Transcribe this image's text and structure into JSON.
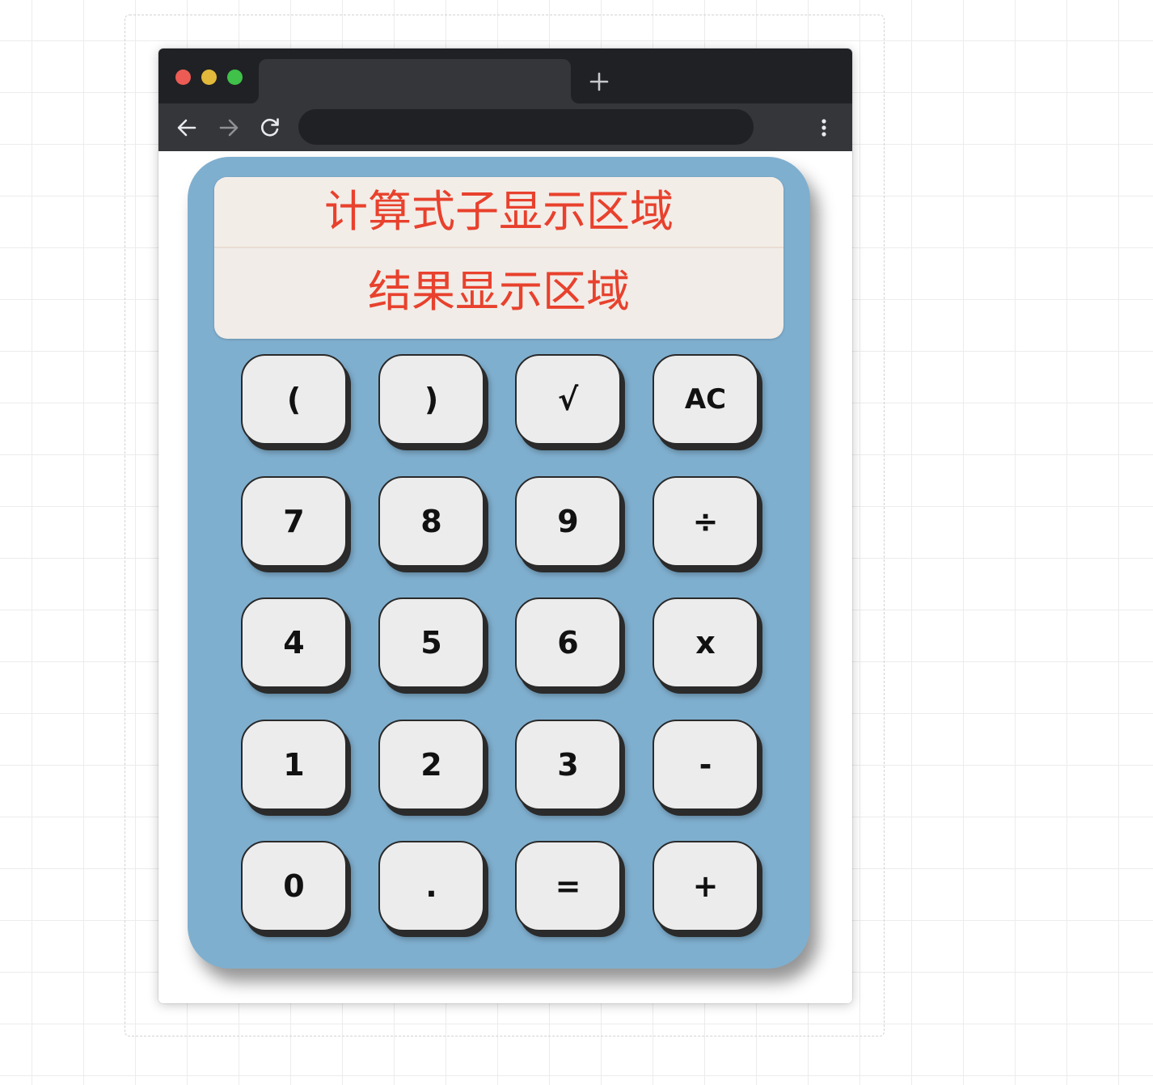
{
  "browser": {
    "tab_title": "",
    "address_bar_value": "",
    "traffic_lights": {
      "close": "#ec5c55",
      "minimize": "#e2b93a",
      "maximize": "#3fc14a"
    }
  },
  "calculator": {
    "display": {
      "expression_text": "计算式子显示区域",
      "result_text": "结果显示区域"
    },
    "keys": [
      {
        "label": "(",
        "name": "open-paren-key"
      },
      {
        "label": ")",
        "name": "close-paren-key"
      },
      {
        "label": "√",
        "name": "sqrt-key"
      },
      {
        "label": "AC",
        "name": "clear-key"
      },
      {
        "label": "7",
        "name": "digit-7-key"
      },
      {
        "label": "8",
        "name": "digit-8-key"
      },
      {
        "label": "9",
        "name": "digit-9-key"
      },
      {
        "label": "÷",
        "name": "divide-key"
      },
      {
        "label": "4",
        "name": "digit-4-key"
      },
      {
        "label": "5",
        "name": "digit-5-key"
      },
      {
        "label": "6",
        "name": "digit-6-key"
      },
      {
        "label": "x",
        "name": "multiply-key"
      },
      {
        "label": "1",
        "name": "digit-1-key"
      },
      {
        "label": "2",
        "name": "digit-2-key"
      },
      {
        "label": "3",
        "name": "digit-3-key"
      },
      {
        "label": "-",
        "name": "minus-key"
      },
      {
        "label": "0",
        "name": "digit-0-key"
      },
      {
        "label": ".",
        "name": "decimal-point-key"
      },
      {
        "label": "=",
        "name": "equals-key"
      },
      {
        "label": "+",
        "name": "plus-key"
      }
    ]
  },
  "colors": {
    "calculator_body": "#7fafcf",
    "display_background": "#f1ece7",
    "display_text": "#e8412d",
    "key_face": "#ececec",
    "browser_frame": "#202124",
    "browser_toolbar": "#35363a"
  }
}
